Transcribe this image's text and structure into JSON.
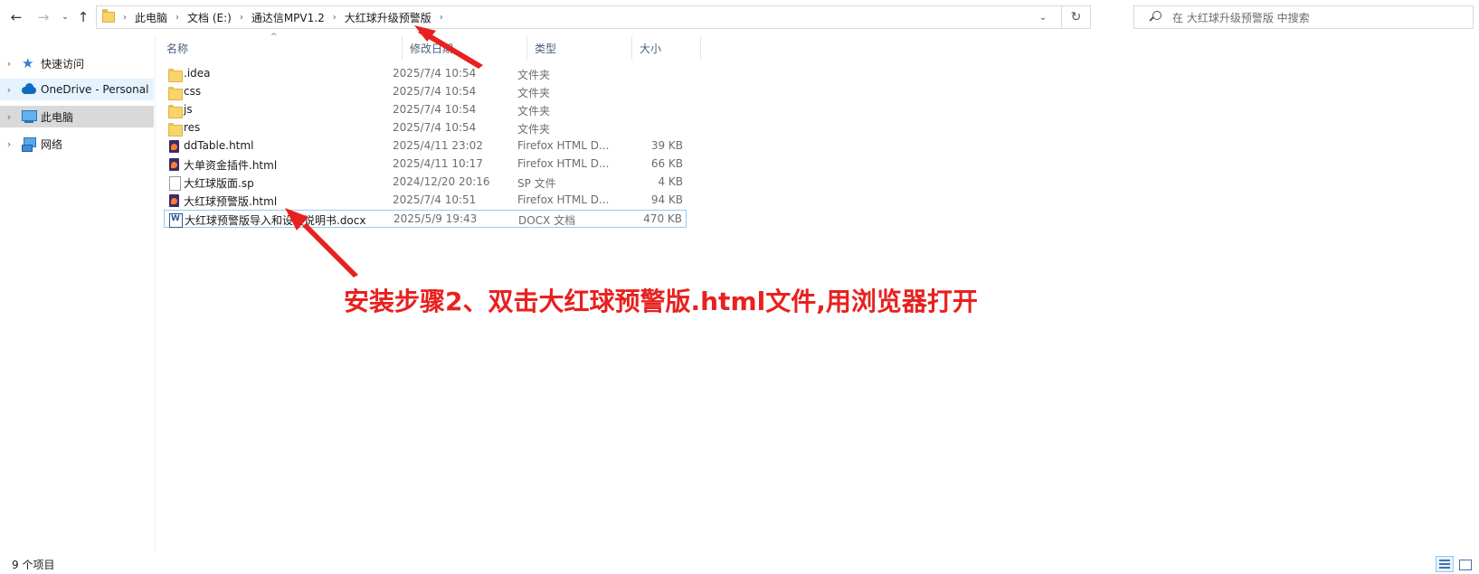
{
  "navigation": {
    "back_glyph": "←",
    "forward_glyph": "→",
    "recent_glyph": "⌄",
    "up_glyph": "↑"
  },
  "address": {
    "crumbs": [
      "此电脑",
      "文档 (E:)",
      "通达信MPV1.2",
      "大红球升级预警版"
    ],
    "separator": "›",
    "dropdown_glyph": "⌄",
    "refresh_glyph": "↻"
  },
  "search": {
    "placeholder": "在 大红球升级预警版 中搜索"
  },
  "sidebar": {
    "items": [
      {
        "label": "快速访问",
        "icon": "star-icon"
      },
      {
        "label": "OneDrive - Personal",
        "icon": "cloud-icon"
      },
      {
        "label": "此电脑",
        "icon": "computer-icon"
      },
      {
        "label": "网络",
        "icon": "network-icon"
      }
    ],
    "chevron": "›"
  },
  "columns": {
    "name": "名称",
    "date": "修改日期",
    "type": "类型",
    "size": "大小",
    "sort_glyph": "^"
  },
  "files": [
    {
      "name": ".idea",
      "date": "2025/7/4 10:54",
      "type": "文件夹",
      "size": "",
      "icon": "folder-icon"
    },
    {
      "name": "css",
      "date": "2025/7/4 10:54",
      "type": "文件夹",
      "size": "",
      "icon": "folder-icon"
    },
    {
      "name": "js",
      "date": "2025/7/4 10:54",
      "type": "文件夹",
      "size": "",
      "icon": "folder-icon"
    },
    {
      "name": "res",
      "date": "2025/7/4 10:54",
      "type": "文件夹",
      "size": "",
      "icon": "folder-icon"
    },
    {
      "name": "ddTable.html",
      "date": "2025/4/11 23:02",
      "type": "Firefox HTML D...",
      "size": "39 KB",
      "icon": "firefox-html-icon"
    },
    {
      "name": "大单资金插件.html",
      "date": "2025/4/11 10:17",
      "type": "Firefox HTML D...",
      "size": "66 KB",
      "icon": "firefox-html-icon"
    },
    {
      "name": "大红球版面.sp",
      "date": "2024/12/20 20:16",
      "type": "SP 文件",
      "size": "4 KB",
      "icon": "file-icon"
    },
    {
      "name": "大红球预警版.html",
      "date": "2025/7/4 10:51",
      "type": "Firefox HTML D...",
      "size": "94 KB",
      "icon": "firefox-html-icon"
    },
    {
      "name": "大红球预警版导入和设置说明书.docx",
      "date": "2025/5/9 19:43",
      "type": "DOCX 文档",
      "size": "470 KB",
      "icon": "word-doc-icon"
    }
  ],
  "annotation": {
    "text": "安装步骤2、双击大红球预警版.html文件,用浏览器打开",
    "color": "#e8211f"
  },
  "status": {
    "item_count": "9 个项目"
  }
}
